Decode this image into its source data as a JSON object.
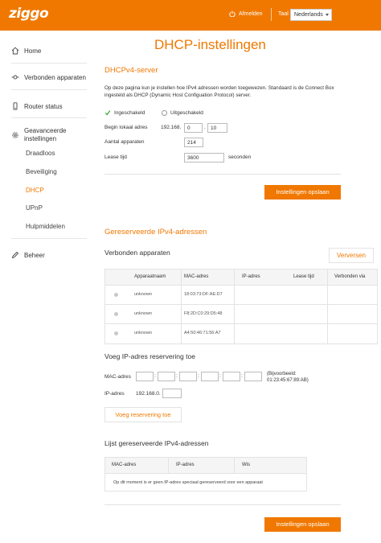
{
  "header": {
    "logo": "ziggo",
    "logout_label": "Afmelden",
    "language_label": "Taal",
    "language_value": "Nederlands",
    "brand_color": "#f07800"
  },
  "sidebar": {
    "items": [
      {
        "label": "Home",
        "icon": "home-icon"
      },
      {
        "label": "Verbonden apparaten",
        "icon": "devices-icon"
      },
      {
        "label": "Router status",
        "icon": "router-icon"
      },
      {
        "label": "Geavanceerde\ninstellingen",
        "icon": "gear-icon"
      },
      {
        "label": "Beheer",
        "icon": "pencil-icon"
      }
    ],
    "subitems": [
      {
        "label": "Draadloos",
        "active": false
      },
      {
        "label": "Beveiliging",
        "active": false
      },
      {
        "label": "DHCP",
        "active": true
      },
      {
        "label": "UPnP",
        "active": false
      },
      {
        "label": "Hulpmiddelen",
        "active": false
      }
    ]
  },
  "main": {
    "title": "DHCP-instellingen",
    "dhcpv4": {
      "title": "DHCPv4-server",
      "description": "Op deze pagina kun je instellen hoe IPv4 adressen worden toegewezen. Standaard is de Connect Box ingesteld als DHCP (Dynamic Host Configuation Protocol) server.",
      "enabled_label": "Ingeschakeld",
      "disabled_label": "Uitgeschakeld",
      "start_label": "Begin lokaal adres",
      "start_prefix": "192.168.",
      "start_octet3": "0",
      "start_octet4": "10",
      "count_label": "Aantal apparaten",
      "count_value": "214",
      "lease_label": "Lease tijd",
      "lease_value": "3600",
      "lease_unit": "seconden",
      "save_label": "Instellingen opslaan"
    },
    "reserved": {
      "title": "Gereserveerde IPv4-adressen",
      "connected_title": "Verbonden apparaten",
      "refresh_label": "Verversen",
      "columns": [
        "Apparaatnaam",
        "MAC-adres",
        "IP-adres",
        "Lease tijd",
        "Verbonden via"
      ],
      "rows": [
        {
          "name": "unknown",
          "mac": "18:03:73:DF:AE:D7",
          "ip": "",
          "lease": "",
          "via": ""
        },
        {
          "name": "unknown",
          "mac": "F8:2D:C0:29:D5:48",
          "ip": "",
          "lease": "",
          "via": ""
        },
        {
          "name": "unknown",
          "mac": "A4:50:46:71:56:A7",
          "ip": "",
          "lease": "",
          "via": ""
        }
      ],
      "add_title": "Voeg IP-adres reservering toe",
      "mac_label": "MAC-adres",
      "mac_example": "(Bijvoorbeeld:\n01:23:45:67:89:AB)",
      "ip_label": "IP-adres",
      "ip_prefix": "192.168.0.",
      "add_button": "Voeg reservering toe",
      "list_title": "Lijst gereserveerde IPv4-adressen",
      "list_columns": [
        "MAC-adres",
        "IP-adres",
        "Wis"
      ],
      "empty_message": "Op dit moment is er geen IP-adres speciaal gereserveerd voor een apparaat",
      "save_label": "Instellingen opslaan"
    }
  }
}
